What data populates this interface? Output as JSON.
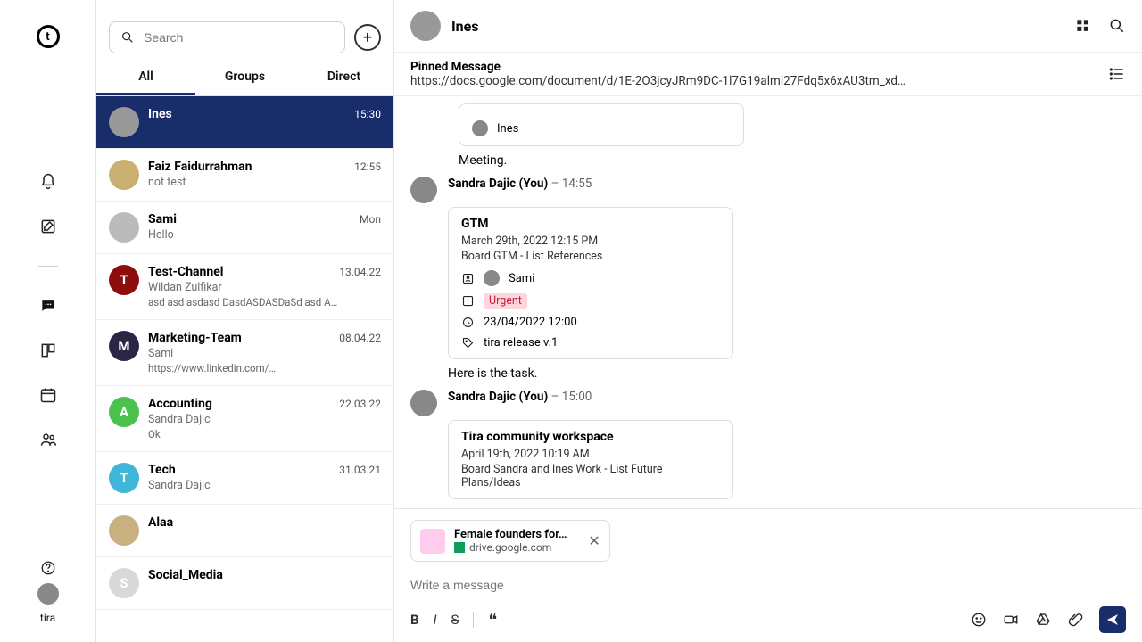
{
  "rail": {
    "workspace": "tira"
  },
  "search": {
    "placeholder": "Search"
  },
  "tabs": {
    "all": "All",
    "groups": "Groups",
    "direct": "Direct"
  },
  "chats": [
    {
      "name": "Ines",
      "time": "15:30",
      "sub": "",
      "extra": "",
      "color": "#999",
      "letter": ""
    },
    {
      "name": "Faiz Faidurrahman",
      "time": "12:55",
      "sub": "not test",
      "extra": "",
      "color": "#c8b070",
      "letter": ""
    },
    {
      "name": "Sami",
      "time": "Mon",
      "sub": "Hello",
      "extra": "",
      "color": "#bbb",
      "letter": ""
    },
    {
      "name": "Test-Channel",
      "time": "13.04.22",
      "sub": "Wildan Zulfikar",
      "extra": "asd asd asdasd DasdASDASDaSd asd A…",
      "color": "#8e0e0e",
      "letter": "T"
    },
    {
      "name": "Marketing-Team",
      "time": "08.04.22",
      "sub": "Sami",
      "extra": "https://www.linkedin.com/…",
      "color": "#2b2546",
      "letter": "M"
    },
    {
      "name": "Accounting",
      "time": "22.03.22",
      "sub": "Sandra Dajic",
      "extra": "Ok",
      "color": "#4bc24b",
      "letter": "A"
    },
    {
      "name": "Tech",
      "time": "31.03.21",
      "sub": "Sandra Dajic",
      "extra": "",
      "color": "#3fb6d8",
      "letter": "T"
    },
    {
      "name": "Alaa",
      "time": "",
      "sub": "",
      "extra": "",
      "color": "#c8b080",
      "letter": ""
    },
    {
      "name": "Social_Media",
      "time": "",
      "sub": "",
      "extra": "",
      "color": "#d9d9d9",
      "letter": "S"
    }
  ],
  "header": {
    "title": "Ines"
  },
  "pinned": {
    "label": "Pinned Message",
    "url": "https://docs.google.com/document/d/1E-2O3jcyJRm9DC-1l7G19alml27Fdq5x6xAU3tm_xdA/edit…"
  },
  "topcard": {
    "assignee": "Ines"
  },
  "msg1": {
    "text": "Meeting."
  },
  "msg2": {
    "author": "Sandra Dajic (You)",
    "time": "– 14:55",
    "card_title": "GTM",
    "card_date": "March 29th, 2022 12:15 PM",
    "card_board": "Board GTM - List References",
    "assignee": "Sami",
    "priority": "Urgent",
    "due": "23/04/2022 12:00",
    "tag": "tira release v.1",
    "text": "Here is the task."
  },
  "msg3": {
    "author": "Sandra Dajic (You)",
    "time": "– 15:00",
    "card_title": "Tira community workspace",
    "card_date": "April 19th, 2022 10:19 AM",
    "card_board": "Board Sandra and Ines Work - List Future Plans/Ideas"
  },
  "attachment": {
    "title": "Female founders for…",
    "source": "drive.google.com"
  },
  "composer": {
    "placeholder": "Write a message"
  }
}
